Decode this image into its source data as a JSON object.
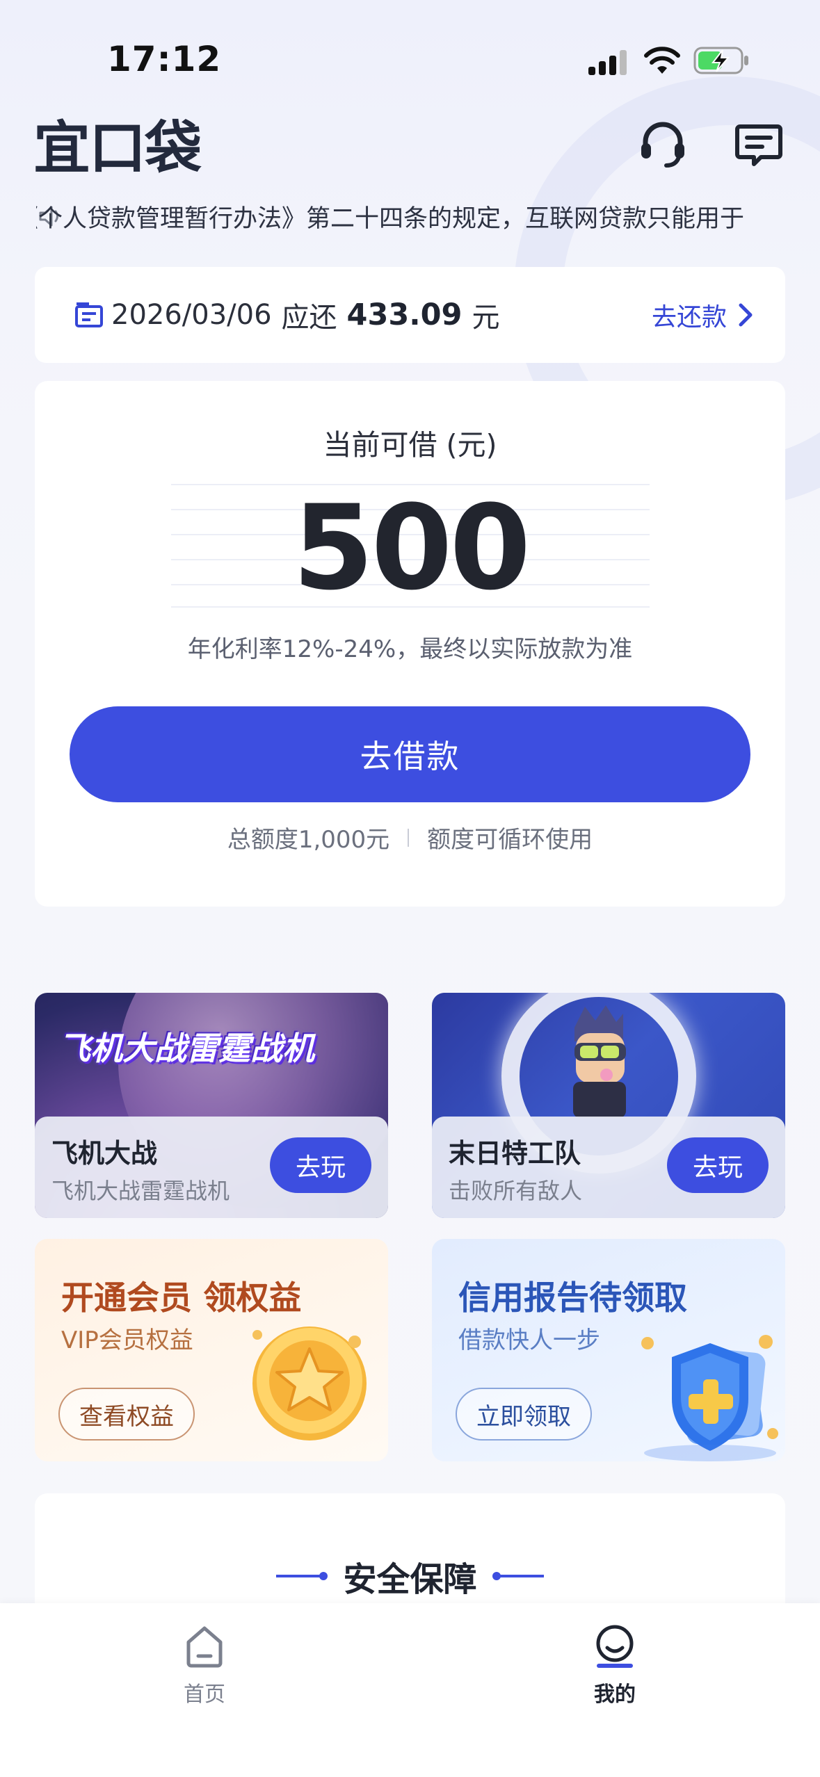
{
  "status_bar": {
    "time": "17:12"
  },
  "header": {
    "logo_text": "宜口袋",
    "icons": [
      "headset-icon",
      "message-icon"
    ]
  },
  "notice": {
    "text": "《个人贷款管理暂行办法》第二十四条的规定，互联网贷款只能用于"
  },
  "repayment": {
    "date": "2026/03/06",
    "label": "应还",
    "amount": "433.09",
    "unit": "元",
    "action": "去还款"
  },
  "borrow": {
    "label": "当前可借 (元)",
    "amount": "500",
    "rate_note": "年化利率12%-24%，最终以实际放款为准",
    "button": "去借款",
    "total_limit": "总额度1,000元",
    "recycle_note": "额度可循环使用"
  },
  "games": [
    {
      "banner": "飞机大战雷霆战机",
      "title": "飞机大战",
      "subtitle": "飞机大战雷霆战机",
      "button": "去玩"
    },
    {
      "title": "末日特工队",
      "subtitle": "击败所有敌人",
      "button": "去玩"
    }
  ],
  "promos": [
    {
      "title": "开通会员 领权益",
      "subtitle": "VIP会员权益",
      "button": "查看权益"
    },
    {
      "title": "信用报告待领取",
      "subtitle": "借款快人一步",
      "button": "立即领取"
    }
  ],
  "security": {
    "title": "安全保障"
  },
  "tabs": [
    {
      "label": "首页",
      "active": false
    },
    {
      "label": "我的",
      "active": true
    }
  ],
  "colors": {
    "primary": "#3d4ee0",
    "link": "#3546d6",
    "vip": "#b04a1f",
    "credit": "#2b56b8"
  }
}
